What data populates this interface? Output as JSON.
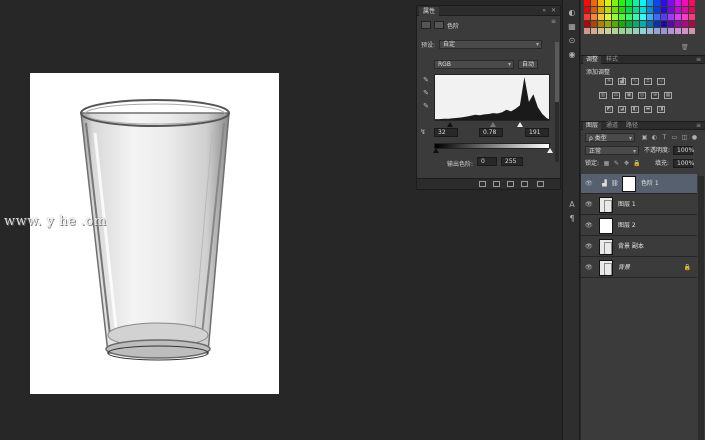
{
  "canvas": {
    "watermark": "www.   y          he    .om"
  },
  "properties_panel": {
    "tab": "属性",
    "layer_type": "色阶",
    "preset_label": "预设:",
    "preset_value": "自定",
    "channel": "RGB",
    "auto_button": "自动",
    "input_black": "32",
    "input_gamma": "0.78",
    "input_white": "191",
    "output_label": "输出色阶:",
    "output_black": "0",
    "output_white": "255"
  },
  "adjustments_panel": {
    "tabs": [
      "调整",
      "样式"
    ],
    "title": "添加调整"
  },
  "layers_panel": {
    "tabs": [
      "图层",
      "通道",
      "路径"
    ],
    "kind_filter": "ρ 类型",
    "blend_mode": "正常",
    "opacity_label": "不透明度:",
    "opacity_value": "100%",
    "lock_label": "锁定:",
    "fill_label": "填充:",
    "fill_value": "100%",
    "layers": [
      {
        "name": "色阶 1"
      },
      {
        "name": "图层 1"
      },
      {
        "name": "图层 2"
      },
      {
        "name": "背景 副本"
      },
      {
        "name": "背景"
      }
    ]
  },
  "chart_data": {
    "type": "area",
    "x_range": [
      0,
      255
    ],
    "title": "",
    "x": [
      0,
      10,
      20,
      30,
      40,
      50,
      60,
      70,
      80,
      90,
      100,
      110,
      120,
      130,
      140,
      150,
      160,
      170,
      180,
      190,
      200,
      210,
      220,
      230,
      240,
      250,
      255
    ],
    "values": [
      2,
      2,
      3,
      3,
      4,
      5,
      6,
      8,
      10,
      12,
      11,
      13,
      14,
      16,
      15,
      18,
      24,
      20,
      26,
      34,
      100,
      42,
      60,
      30,
      14,
      4,
      2
    ]
  },
  "colors": {
    "workspace": "#272727",
    "panel": "#3b3b3b",
    "selected_layer": "#56606e"
  }
}
